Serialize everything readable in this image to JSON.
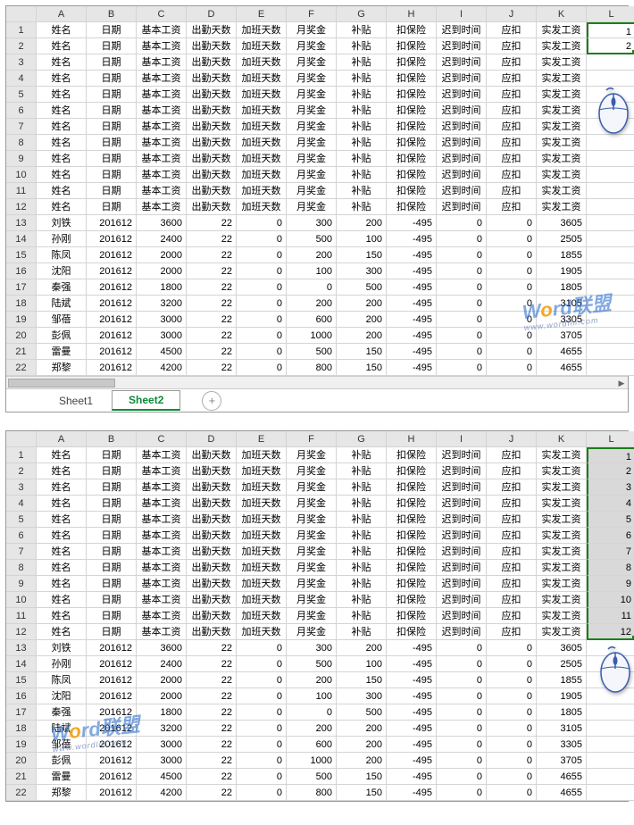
{
  "columns": [
    "A",
    "B",
    "C",
    "D",
    "E",
    "F",
    "G",
    "H",
    "I",
    "J",
    "K",
    "L"
  ],
  "header_row": [
    "姓名",
    "日期",
    "基本工资",
    "出勤天数",
    "加班天数",
    "月奖金",
    "补贴",
    "扣保险",
    "迟到时间",
    "应扣",
    "实发工资"
  ],
  "data_rows": [
    [
      "刘铁",
      "201612",
      "3600",
      "22",
      "0",
      "300",
      "200",
      "-495",
      "0",
      "0",
      "3605"
    ],
    [
      "孙刚",
      "201612",
      "2400",
      "22",
      "0",
      "500",
      "100",
      "-495",
      "0",
      "0",
      "2505"
    ],
    [
      "陈凤",
      "201612",
      "2000",
      "22",
      "0",
      "200",
      "150",
      "-495",
      "0",
      "0",
      "1855"
    ],
    [
      "沈阳",
      "201612",
      "2000",
      "22",
      "0",
      "100",
      "300",
      "-495",
      "0",
      "0",
      "1905"
    ],
    [
      "秦强",
      "201612",
      "1800",
      "22",
      "0",
      "0",
      "500",
      "-495",
      "0",
      "0",
      "1805"
    ],
    [
      "陆斌",
      "201612",
      "3200",
      "22",
      "0",
      "200",
      "200",
      "-495",
      "0",
      "0",
      "3105"
    ],
    [
      "邹蓓",
      "201612",
      "3000",
      "22",
      "0",
      "600",
      "200",
      "-495",
      "0",
      "0",
      "3305"
    ],
    [
      "彭佩",
      "201612",
      "3000",
      "22",
      "0",
      "1000",
      "200",
      "-495",
      "0",
      "0",
      "3705"
    ],
    [
      "雷曼",
      "201612",
      "4500",
      "22",
      "0",
      "500",
      "150",
      "-495",
      "0",
      "0",
      "4655"
    ],
    [
      "郑黎",
      "201612",
      "4200",
      "22",
      "0",
      "800",
      "150",
      "-495",
      "0",
      "0",
      "4655"
    ]
  ],
  "top_panel": {
    "L_values": [
      "1",
      "2"
    ],
    "selected_count": 2,
    "header_repeat": 12
  },
  "bottom_panel": {
    "L_values": [
      "1",
      "2",
      "3",
      "4",
      "5",
      "6",
      "7",
      "8",
      "9",
      "10",
      "11",
      "12"
    ],
    "selected_count": 12,
    "header_repeat": 12
  },
  "tabs": {
    "items": [
      "Sheet1",
      "Sheet2"
    ],
    "active": 1,
    "add_label": "+"
  },
  "watermark": {
    "text_pre": "W",
    "text_o": "o",
    "text_post": "rd联盟",
    "sub": "www.wordlm.com"
  }
}
